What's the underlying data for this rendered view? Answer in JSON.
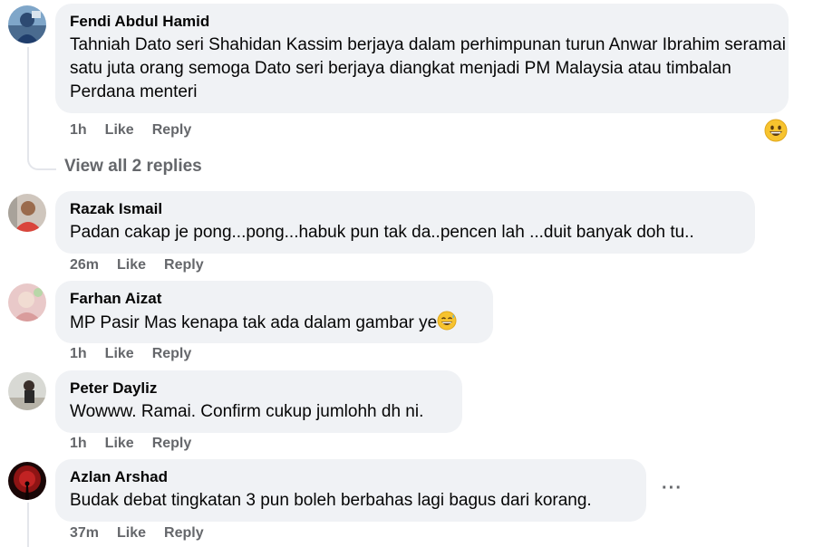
{
  "comments": [
    {
      "author": "Fendi Abdul Hamid",
      "text": "Tahniah Dato seri Shahidan Kassim berjaya dalam perhimpunan turun Anwar Ibrahim seramai satu juta orang semoga Dato seri berjaya diangkat menjadi PM Malaysia atau timbalan Perdana menteri",
      "time": "1h",
      "like": "Like",
      "reply": "Reply",
      "reaction_icon": "grinning-emoji"
    },
    {
      "author": "Razak Ismail",
      "text": "Padan cakap je pong...pong...habuk pun tak da..pencen lah ...duit banyak doh tu..",
      "time": "26m",
      "like": "Like",
      "reply": "Reply"
    },
    {
      "author": "Farhan Aizat",
      "text": "MP Pasir Mas kenapa tak ada dalam gambar ye",
      "text_emoji": "sweat-smile-emoji",
      "time": "1h",
      "like": "Like",
      "reply": "Reply"
    },
    {
      "author": "Peter Dayliz",
      "text": "Wowww. Ramai. Confirm cukup jumlohh dh ni.",
      "time": "1h",
      "like": "Like",
      "reply": "Reply"
    },
    {
      "author": "Azlan Arshad",
      "text": "Budak debat tingkatan 3 pun boleh berbahas lagi bagus dari korang.",
      "time": "37m",
      "like": "Like",
      "reply": "Reply",
      "more_icon": "more-options-icon"
    }
  ],
  "view_replies": "View all 2 replies"
}
